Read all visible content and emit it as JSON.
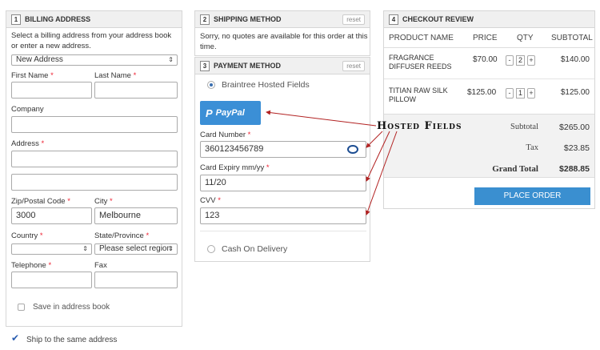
{
  "billing": {
    "num": "1",
    "title": "BILLING ADDRESS",
    "intro": "Select a billing address from your address book or enter a new address.",
    "address_select": "New Address",
    "first_name_label": "First Name",
    "last_name_label": "Last Name",
    "company_label": "Company",
    "address_label": "Address",
    "zip_label": "Zip/Postal Code",
    "zip_value": "3000",
    "city_label": "City",
    "city_value": "Melbourne",
    "country_label": "Country",
    "country_value": "",
    "state_label": "State/Province",
    "state_value": "Please select region",
    "telephone_label": "Telephone",
    "fax_label": "Fax",
    "save_label": "Save in address book",
    "required": "*"
  },
  "ship_same": "Ship to the same address",
  "shipping": {
    "num": "2",
    "title": "SHIPPING METHOD",
    "reset": "reset",
    "message": "Sorry, no quotes are available for this order at this time."
  },
  "payment": {
    "num": "3",
    "title": "PAYMENT METHOD",
    "reset": "reset",
    "option1": "Braintree Hosted Fields",
    "paypal_label": "PayPal",
    "card_number_label": "Card Number",
    "card_number_value": "360123456789",
    "expiry_label": "Card Expiry mm/yy",
    "expiry_value": "11/20",
    "cvv_label": "CVV",
    "cvv_value": "123",
    "option2": "Cash On Delivery",
    "required": "*"
  },
  "review": {
    "num": "4",
    "title": "CHECKOUT REVIEW",
    "headers": [
      "PRODUCT NAME",
      "PRICE",
      "QTY",
      "SUBTOTAL"
    ],
    "items": [
      {
        "name": "FRAGRANCE DIFFUSER REEDS",
        "price": "$70.00",
        "qty": "2",
        "subtotal": "$140.00"
      },
      {
        "name": "TITIAN RAW SILK PILLOW",
        "price": "$125.00",
        "qty": "1",
        "subtotal": "$125.00"
      }
    ],
    "subtotal_label": "Subtotal",
    "subtotal_value": "$265.00",
    "tax_label": "Tax",
    "tax_value": "$23.85",
    "grand_label": "Grand Total",
    "grand_value": "$288.85",
    "place_order": "PLACE ORDER",
    "minus": "-",
    "plus": "+"
  },
  "annotation": "Hosted Fields",
  "colors": {
    "accent": "#3a8fd0",
    "paypal": "#3b8fd6",
    "arrow": "#b22222"
  }
}
